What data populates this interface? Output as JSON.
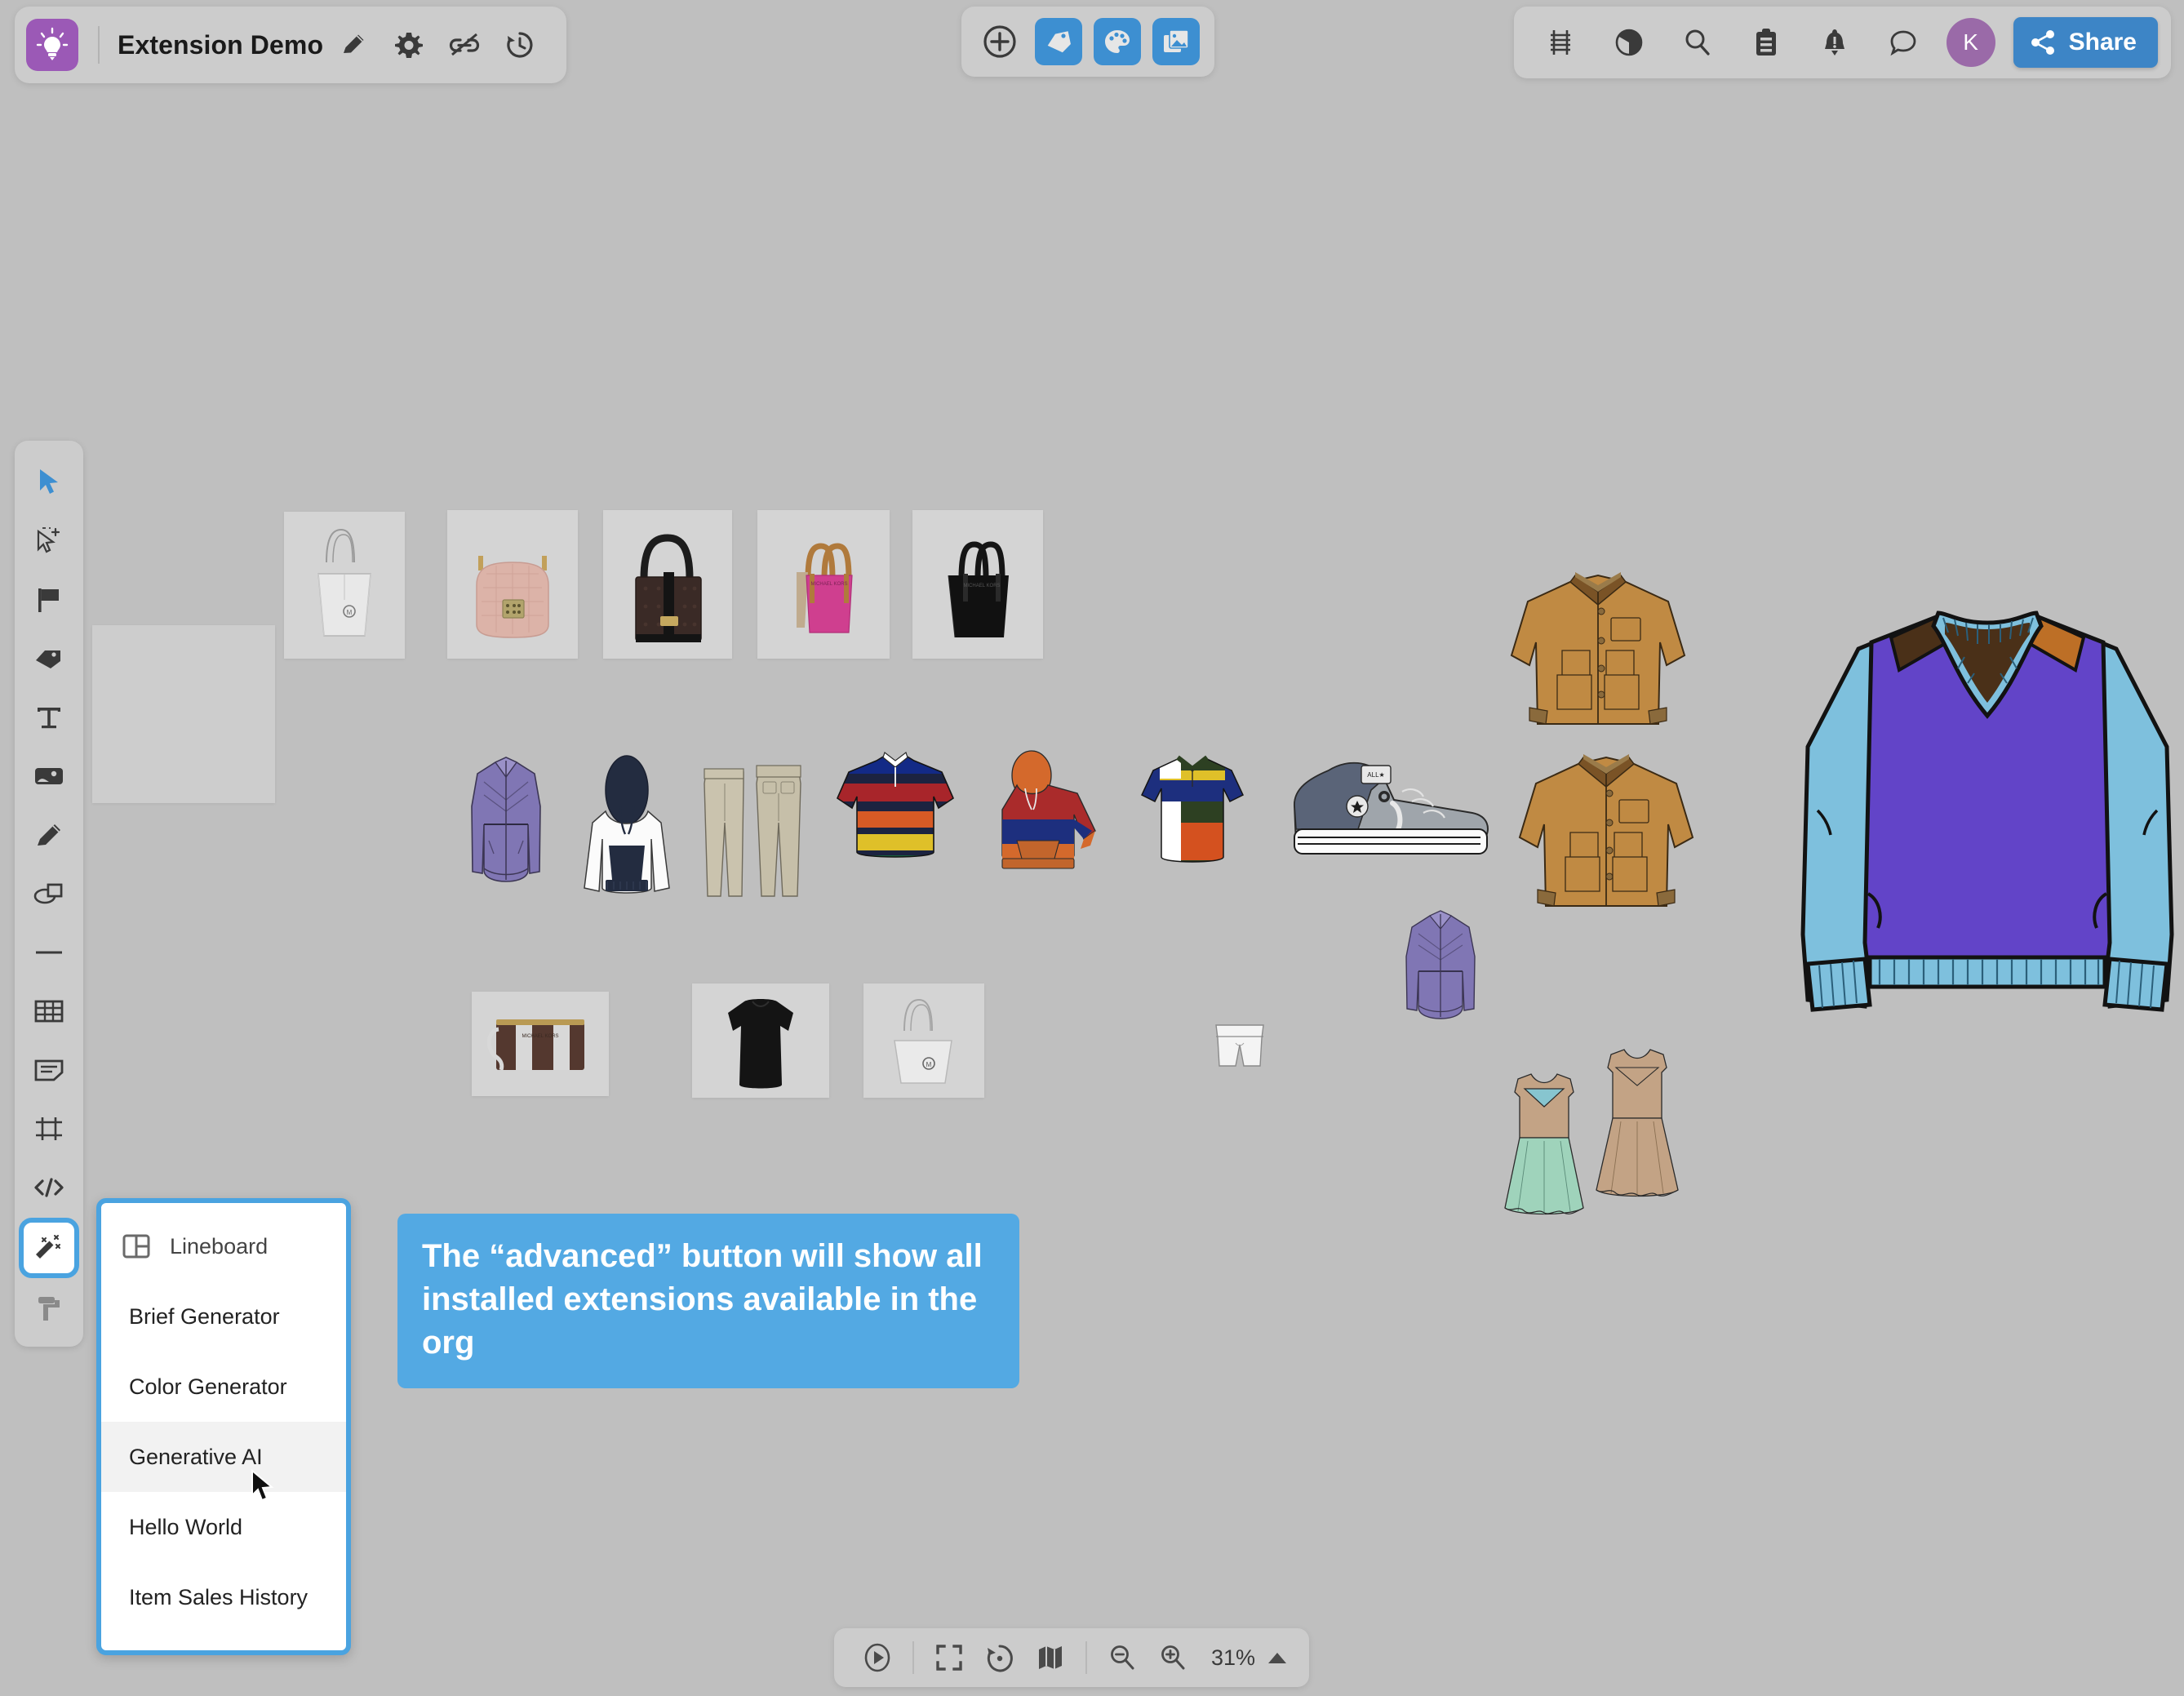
{
  "header": {
    "logo_icon": "lightbulb-idea-icon",
    "board_title": "Extension Demo",
    "title_actions": [
      {
        "name": "edit-title-icon",
        "label": "Edit"
      },
      {
        "name": "board-settings-icon",
        "label": "Settings"
      },
      {
        "name": "unlink-icon",
        "label": "Unlink"
      },
      {
        "name": "version-history-icon",
        "label": "History"
      }
    ]
  },
  "center_toolbar": {
    "items": [
      {
        "name": "add-circle-icon",
        "label": "Add",
        "style": "plain",
        "active": false
      },
      {
        "name": "tag-icon",
        "label": "Tags",
        "style": "blue",
        "active": true
      },
      {
        "name": "palette-icon",
        "label": "Colors",
        "style": "blue",
        "active": true
      },
      {
        "name": "images-icon",
        "label": "Images",
        "style": "blue",
        "active": true
      }
    ]
  },
  "right_toolbar": {
    "items": [
      {
        "name": "ladder-grid-icon",
        "label": "Grid"
      },
      {
        "name": "contrast-pie-icon",
        "label": "Contrast"
      },
      {
        "name": "search-icon",
        "label": "Search"
      },
      {
        "name": "clipboard-icon",
        "label": "Clipboard"
      },
      {
        "name": "notifications-bell-icon",
        "label": "Notifications"
      },
      {
        "name": "comment-icon",
        "label": "Comments"
      }
    ],
    "avatar_initial": "K",
    "share_label": "Share",
    "share_icon": "share-nodes-icon"
  },
  "left_toolbar": {
    "items": [
      {
        "name": "select-arrow-tool",
        "label": "Select",
        "active": true
      },
      {
        "name": "multi-select-tool",
        "label": "Multi select",
        "active": false
      },
      {
        "name": "flag-tool",
        "label": "Flag",
        "active": false
      },
      {
        "name": "tag-tool",
        "label": "Tag",
        "active": false
      },
      {
        "name": "text-tool",
        "label": "Text",
        "active": false
      },
      {
        "name": "image-tool",
        "label": "Image",
        "active": false
      },
      {
        "name": "pencil-tool",
        "label": "Pencil",
        "active": false
      },
      {
        "name": "shapes-tool",
        "label": "Shapes",
        "active": false
      },
      {
        "name": "line-tool",
        "label": "Line",
        "active": false
      },
      {
        "name": "table-tool",
        "label": "Table",
        "active": false
      },
      {
        "name": "sticky-note-tool",
        "label": "Sticky note",
        "active": false
      },
      {
        "name": "frame-tool",
        "label": "Frame",
        "active": false
      },
      {
        "name": "embed-code-tool",
        "label": "Embed code",
        "active": false
      },
      {
        "name": "magic-wand-extensions-tool",
        "label": "Extensions",
        "active": true
      },
      {
        "name": "paint-roller-tool",
        "label": "Paint roller",
        "active": false
      }
    ]
  },
  "extensions_menu": {
    "header": {
      "icon": "lineboard-layout-icon",
      "label": "Lineboard"
    },
    "items": [
      {
        "label": "Brief Generator",
        "highlighted": false
      },
      {
        "label": "Color Generator",
        "highlighted": false
      },
      {
        "label": "Generative AI",
        "highlighted": true
      },
      {
        "label": "Hello World",
        "highlighted": false
      },
      {
        "label": "Item Sales History",
        "highlighted": false
      }
    ]
  },
  "callout": {
    "text": "The “advanced” button will show all installed extensions available in the org",
    "color": "#53a9e3"
  },
  "bottom_toolbar": {
    "items": [
      {
        "name": "play-presentation-icon",
        "label": "Present"
      },
      {
        "name": "fit-to-screen-icon",
        "label": "Fit to screen"
      },
      {
        "name": "reset-zoom-icon",
        "label": "Reset zoom"
      },
      {
        "name": "minimap-icon",
        "label": "Minimap"
      },
      {
        "name": "zoom-out-icon",
        "label": "Zoom out"
      },
      {
        "name": "zoom-in-icon",
        "label": "Zoom in"
      }
    ],
    "zoom_level": "31%",
    "zoom_chevron": "chevron-up-icon"
  },
  "canvas": {
    "placeholder_card": {
      "name": "empty-placeholder-card"
    },
    "handbag_tiles": [
      {
        "name": "handbag-tile-white-tote"
      },
      {
        "name": "handbag-tile-pink-quilted-flap"
      },
      {
        "name": "handbag-tile-black-flap"
      },
      {
        "name": "handbag-tile-magenta-tote"
      },
      {
        "name": "handbag-tile-black-tote"
      }
    ],
    "bottom_tiles": [
      {
        "name": "accessory-tile-striped-wristlet"
      },
      {
        "name": "apparel-tile-black-tee-dress"
      },
      {
        "name": "handbag-tile-white-tote-small"
      }
    ],
    "flat_sketches": [
      {
        "name": "flat-purple-puffer-jacket"
      },
      {
        "name": "flat-white-navy-hoodie"
      },
      {
        "name": "flat-khaki-pants-pair"
      },
      {
        "name": "flat-striped-rugby-shirt"
      },
      {
        "name": "flat-colorblock-hoodie"
      },
      {
        "name": "flat-colorblock-polo"
      },
      {
        "name": "flat-gray-high-top-sneaker"
      },
      {
        "name": "flat-tan-chore-jacket-top"
      },
      {
        "name": "flat-tan-chore-jacket-bottom"
      },
      {
        "name": "flat-small-purple-puffer"
      },
      {
        "name": "flat-white-bike-shorts"
      },
      {
        "name": "flat-mint-dress"
      },
      {
        "name": "flat-tan-dress"
      },
      {
        "name": "flat-purple-v-neck-sweater"
      }
    ]
  },
  "colors": {
    "canvas_bg": "#bfbfbf",
    "chrome_bg": "#cccccc",
    "accent_blue": "#3d85c6",
    "highlight_blue": "#4aa3e0",
    "logo_purple": "#9b59b6",
    "avatar_purple": "#9a6aa8"
  }
}
